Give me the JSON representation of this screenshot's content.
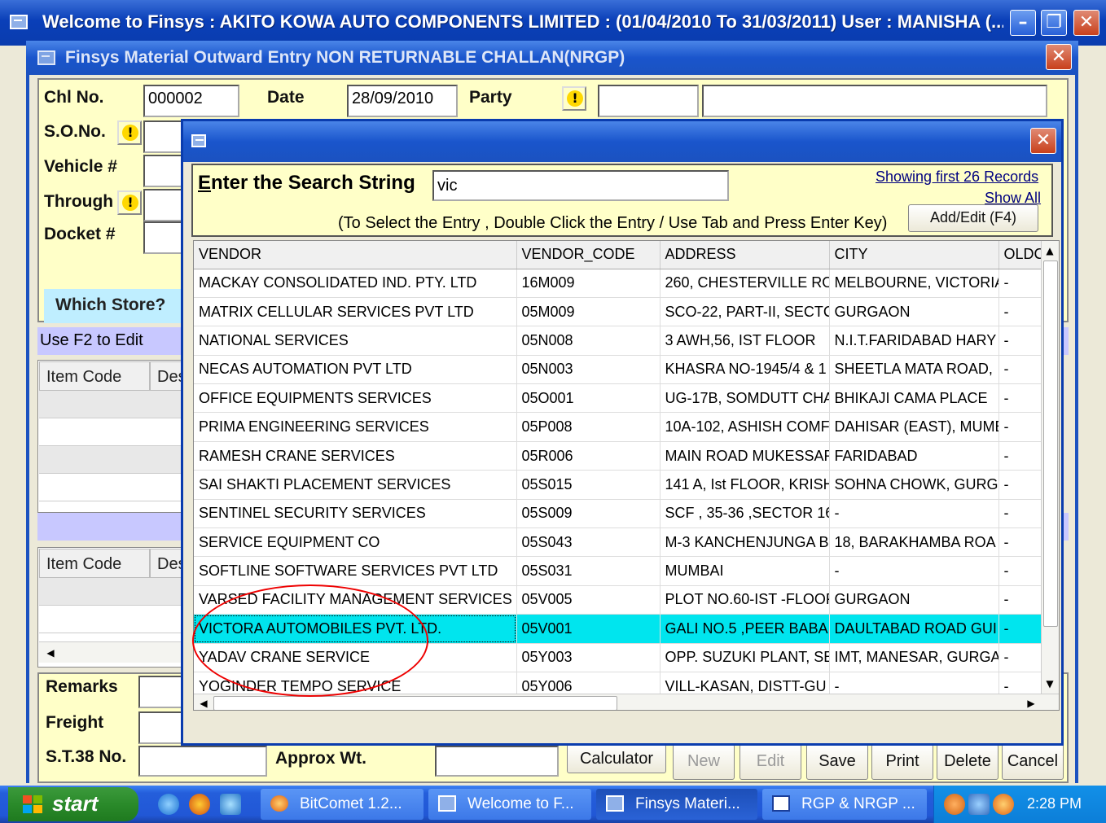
{
  "app_window": {
    "title": "Welcome to Finsys : AKITO KOWA AUTO COMPONENTS LIMITED : (01/04/2010 To 31/03/2011) User : MANISHA (..."
  },
  "entry_window": {
    "title": "Finsys Material Outward Entry NON RETURNABLE CHALLAN(NRGP)"
  },
  "form": {
    "chl_label": "Chl No.",
    "chl_value": "000002",
    "date_label": "Date",
    "date_value": "28/09/2010",
    "party_label": "Party",
    "so_label": "S.O.No.",
    "vehicle_label": "Vehicle #",
    "through_label": "Through",
    "docket_label": "Docket #",
    "which_store": "Which Store?",
    "f2_hint": "Use F2 to Edit",
    "grid1_col1": "Item Code",
    "grid1_col2": "Des",
    "grid2_col1": "Item Code",
    "grid2_col2": "Des",
    "remarks_label": "Remarks",
    "freight_label": "Freight",
    "st38_label": "S.T.38 No.",
    "approx_wt_label": "Approx Wt."
  },
  "buttons": {
    "calculator": "Calculator",
    "new": "New",
    "edit": "Edit",
    "save": "Save",
    "print": "Print",
    "delete": "Delete",
    "cancel": "Cancel"
  },
  "search_dialog": {
    "label_first": "E",
    "label_rest": "nter the Search String",
    "search_value": "vic",
    "showing": "Showing first 26 Records",
    "show_all": "Show All",
    "hint": "(To Select the Entry , Double Click the Entry / Use Tab and Press Enter Key)",
    "add_edit": "Add/Edit (F4)",
    "columns": [
      "VENDOR",
      "VENDOR_CODE",
      "ADDRESS",
      "CITY",
      "OLDC"
    ],
    "rows": [
      [
        "MACKAY CONSOLIDATED IND. PTY. LTD",
        "16M009",
        "260, CHESTERVILLE RO",
        "MELBOURNE, VICTORIA",
        "-"
      ],
      [
        "MATRIX CELLULAR SERVICES PVT LTD",
        "05M009",
        "SCO-22, PART-II, SECTC",
        "GURGAON",
        "-"
      ],
      [
        "NATIONAL SERVICES",
        "05N008",
        "3 AWH,56, IST FLOOR",
        "N.I.T.FARIDABAD HARY",
        "-"
      ],
      [
        "NECAS AUTOMATION PVT LTD",
        "05N003",
        "KHASRA NO-1945/4 & 1",
        "SHEETLA MATA ROAD,",
        "-"
      ],
      [
        "OFFICE EQUIPMENTS SERVICES",
        "05O001",
        "UG-17B, SOMDUTT CHA",
        "BHIKAJI CAMA PLACE",
        "-"
      ],
      [
        "PRIMA ENGINEERING SERVICES",
        "05P008",
        "10A-102, ASHISH COMF",
        "DAHISAR (EAST), MUME",
        "-"
      ],
      [
        "RAMESH CRANE SERVICES",
        "05R006",
        "MAIN ROAD MUKESSAR",
        "FARIDABAD",
        "-"
      ],
      [
        "SAI SHAKTI PLACEMENT SERVICES",
        "05S015",
        "141 A, Ist FLOOR, KRISH",
        "SOHNA CHOWK, GURG.",
        "-"
      ],
      [
        "SENTINEL SECURITY SERVICES",
        "05S009",
        "SCF , 35-36 ,SECTOR 16",
        "-",
        "-"
      ],
      [
        "SERVICE EQUIPMENT CO",
        "05S043",
        "M-3 KANCHENJUNGA BI",
        "18, BARAKHAMBA ROA",
        "-"
      ],
      [
        "SOFTLINE SOFTWARE SERVICES PVT LTD",
        "05S031",
        "MUMBAI",
        "-",
        "-"
      ],
      [
        "VARSED FACILITY MANAGEMENT SERVICES P",
        "05V005",
        "PLOT NO.60-IST -FLOOF",
        "GURGAON",
        "-"
      ],
      [
        "VICTORA AUTOMOBILES PVT. LTD.",
        "05V001",
        "GALI NO.5 ,PEER BABA",
        "DAULTABAD ROAD GUI",
        "-"
      ],
      [
        "YADAV CRANE SERVICE",
        "05Y003",
        "OPP. SUZUKI PLANT, SE",
        "IMT, MANESAR, GURGA",
        "-"
      ],
      [
        "YOGINDER TEMPO SERVICE",
        "05Y006",
        "VILL-KASAN, DISTT-GU",
        "-",
        "-"
      ]
    ],
    "selected_index": 12
  },
  "taskbar": {
    "start": "start",
    "tasks": [
      "BitComet 1.2...",
      "Welcome to F...",
      "Finsys Materi...",
      "RGP & NRGP ..."
    ],
    "clock": "2:28 PM"
  }
}
